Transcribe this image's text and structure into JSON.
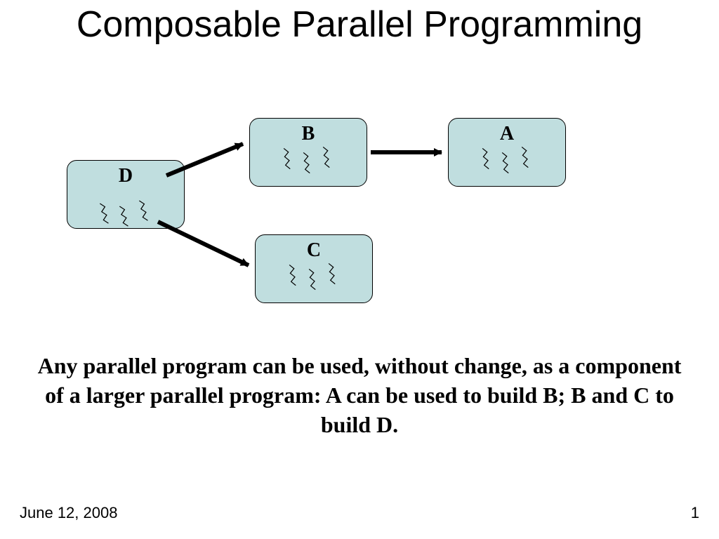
{
  "title": "Composable Parallel Programming",
  "nodes": {
    "D": {
      "label": "D"
    },
    "B": {
      "label": "B"
    },
    "A": {
      "label": "A"
    },
    "C": {
      "label": "C"
    }
  },
  "body": "Any parallel program can be used, without change, as a component of a larger parallel program: A can be used to build B; B and C to build D.",
  "footer": {
    "date": "June 12, 2008",
    "page": "1"
  },
  "colors": {
    "node_fill": "#c0dedf",
    "node_stroke": "#000000"
  }
}
